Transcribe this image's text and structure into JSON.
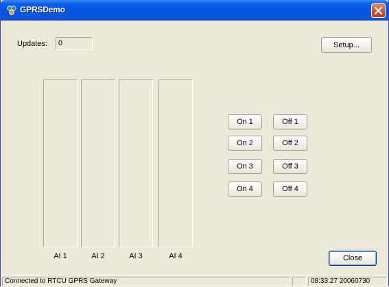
{
  "window": {
    "title": "GPRSDemo",
    "icon": "app-icon",
    "close_icon": "close-icon"
  },
  "updates": {
    "label": "Updates:",
    "value": "0"
  },
  "setup_button": {
    "label": "Setup..."
  },
  "analog_inputs": [
    {
      "label": "AI 1",
      "level": 0
    },
    {
      "label": "AI 2",
      "level": 0
    },
    {
      "label": "AI 3",
      "level": 0
    },
    {
      "label": "AI 4",
      "level": 0
    }
  ],
  "outputs": [
    {
      "on_label": "On 1",
      "off_label": "Off 1"
    },
    {
      "on_label": "On 2",
      "off_label": "Off 2"
    },
    {
      "on_label": "On 3",
      "off_label": "Off 3"
    },
    {
      "on_label": "On 4",
      "off_label": "Off 4"
    }
  ],
  "close_button": {
    "label": "Close"
  },
  "status": {
    "connection": "Connected to RTCU GPRS Gateway",
    "empty_pane": "",
    "timestamp": "08:33:27 20060730"
  },
  "colors": {
    "title_bar": "#0054e3",
    "close_button": "#d2502d",
    "bar_fill": "#1f8f3a"
  }
}
